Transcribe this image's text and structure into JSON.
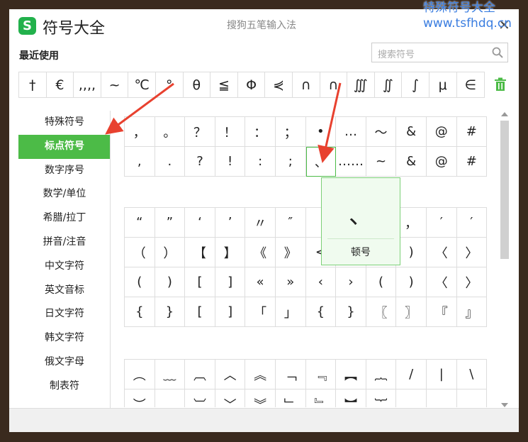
{
  "window": {
    "title": "符号大全",
    "subtitle": "搜狗五笔输入法",
    "logo_letter": "S",
    "close_label": "✕"
  },
  "watermark": {
    "line1": "特殊符号大全",
    "line2": "www.tsfhdq.cn"
  },
  "recent": {
    "title": "最近使用",
    "symbols": [
      "†",
      "€",
      ",,,,",
      "~",
      "℃",
      "°",
      "θ",
      "≦",
      "Φ",
      "⋞",
      "∩",
      "∩",
      "∭",
      "∬",
      "∫",
      "μ",
      "∈"
    ]
  },
  "search": {
    "placeholder": "搜索符号"
  },
  "sidebar": {
    "items": [
      {
        "label": "特殊符号"
      },
      {
        "label": "标点符号",
        "active": true
      },
      {
        "label": "数字序号"
      },
      {
        "label": "数学/单位"
      },
      {
        "label": "希腊/拉丁"
      },
      {
        "label": "拼音/注音"
      },
      {
        "label": "中文字符"
      },
      {
        "label": "英文音标"
      },
      {
        "label": "日文字符"
      },
      {
        "label": "韩文字符"
      },
      {
        "label": "俄文字母"
      },
      {
        "label": "制表符"
      }
    ]
  },
  "grid1": [
    [
      "，",
      "。",
      "？",
      "！",
      "：",
      "；",
      "•",
      "…",
      "～",
      "&",
      "@",
      "#"
    ],
    [
      ",",
      ".",
      "?",
      "!",
      ":",
      ";",
      "、",
      "……",
      "~",
      "&",
      "@",
      "#"
    ]
  ],
  "grid2": [
    [
      "“",
      "”",
      "‘",
      "’",
      "〃",
      "″",
      "",
      "",
      "",
      "，",
      "′",
      "′"
    ],
    [
      "（",
      "）",
      "【",
      "】",
      "《",
      "》",
      "<",
      "",
      "",
      ")",
      "〈",
      "〉"
    ],
    [
      "(",
      ")",
      "[",
      "]",
      "«",
      "»",
      "‹",
      "›",
      "(",
      ")",
      "〈",
      "〉"
    ],
    [
      "{",
      "}",
      "[",
      "]",
      "「",
      "」",
      "{",
      "}",
      "〖",
      "〗",
      "『",
      "』"
    ]
  ],
  "grid3": [
    [
      "︵",
      "﹏",
      "︹",
      "︿",
      "︽",
      "﹁",
      "﹃",
      "︻",
      "︷",
      "/",
      "|",
      "\\"
    ],
    [
      "︶",
      "﹏",
      "︺",
      "﹀",
      "︾",
      "﹂",
      "﹄",
      "︼",
      "︸",
      "",
      "",
      ""
    ]
  ],
  "popup": {
    "symbol": "、",
    "name": "顿号"
  },
  "colors": {
    "accent": "#4cbb47",
    "arrow": "#e8412f",
    "watermark": "#3a7de0"
  }
}
